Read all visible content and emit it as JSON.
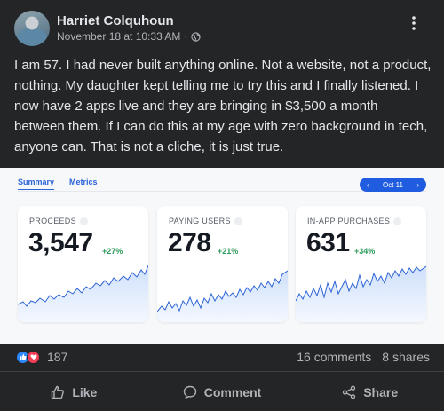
{
  "post": {
    "author": "Harriet Colquhoun",
    "timestamp": "November 18 at 10:33 AM",
    "separator": "·",
    "audience_icon": "globe-icon",
    "body": "I am 57. I had never built anything online. Not a website, not a product, nothing. My daughter kept telling me to try this and I finally listened. I now have 2 apps live and they are bringing in $3,500 a month between them. If I can do this at my age with zero background in tech, anyone can. That is not a cliche, it is just true."
  },
  "dashboard": {
    "tabs": [
      "Summary",
      "Metrics"
    ],
    "date": {
      "prev": "‹",
      "label": "Oct 11",
      "next": "›"
    },
    "accent": "#1f5ce0",
    "cards": [
      {
        "title": "PROCEEDS",
        "value": "3,547",
        "change": "+27%"
      },
      {
        "title": "PAYING USERS",
        "value": "278",
        "change": "+21%"
      },
      {
        "title": "IN-APP PURCHASES",
        "value": "631",
        "change": "+34%"
      }
    ]
  },
  "engagement": {
    "reaction_icons": [
      "like-icon",
      "love-icon"
    ],
    "reaction_count": "187",
    "comments": "16 comments",
    "shares": "8 shares"
  },
  "actions": {
    "like": "Like",
    "comment": "Comment",
    "share": "Share"
  },
  "colors": {
    "background": "#242526",
    "text": "#e4e6eb",
    "muted": "#b0b3b8",
    "positive": "#2d9b5a",
    "like_blue": "#2d88ff",
    "love_red": "#f33e58"
  }
}
